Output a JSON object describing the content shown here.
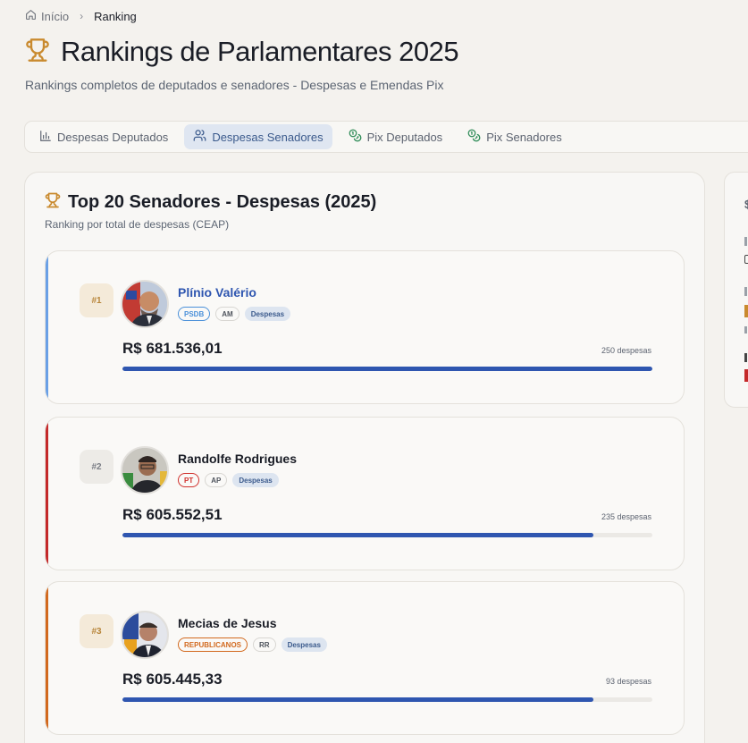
{
  "breadcrumb": {
    "home_label": "Início",
    "current": "Ranking"
  },
  "page": {
    "title": "Rankings de Parlamentares 2025",
    "subtitle": "Rankings completos de deputados e senadores - Despesas e Emendas Pix"
  },
  "tabs": [
    {
      "label": "Despesas Deputados",
      "icon": "bar-chart-icon",
      "active": false
    },
    {
      "label": "Despesas Senadores",
      "icon": "users-icon",
      "active": true
    },
    {
      "label": "Pix Deputados",
      "icon": "coins-icon",
      "active": false
    },
    {
      "label": "Pix Senadores",
      "icon": "coins-icon",
      "active": false
    }
  ],
  "section": {
    "title": "Top 20 Senadores - Despesas (2025)",
    "subtitle": "Ranking por total de despesas (CEAP)"
  },
  "ranking": [
    {
      "rank": "#1",
      "name": "Plínio Valério",
      "party": "PSDB",
      "state": "AM",
      "kind": "Despesas",
      "amount": "R$ 681.536,01",
      "count": "250 despesas",
      "progress": 1.0,
      "accent": "#6aa0e6",
      "name_color": "#2f56b0",
      "party_color": "#4a90d9",
      "badge_bg": "#f4ead9",
      "badge_color": "#b8863b"
    },
    {
      "rank": "#2",
      "name": "Randolfe Rodrigues",
      "party": "PT",
      "state": "AP",
      "kind": "Despesas",
      "amount": "R$ 605.552,51",
      "count": "235 despesas",
      "progress": 0.889,
      "accent": "#c4292a",
      "name_color": "#1a1d26",
      "party_color": "#d0312d",
      "badge_bg": "#edebe7",
      "badge_color": "#7a7d85"
    },
    {
      "rank": "#3",
      "name": "Mecias de Jesus",
      "party": "REPUBLICANOS",
      "state": "RR",
      "kind": "Despesas",
      "amount": "R$ 605.445,33",
      "count": "93 despesas",
      "progress": 0.888,
      "accent": "#d2691e",
      "name_color": "#1a1d26",
      "party_color": "#d2691e",
      "badge_bg": "#f4ead9",
      "badge_color": "#b8863b"
    }
  ],
  "colors": {
    "accent_gold": "#c98a2e",
    "tab_active_bg": "#dfe6f1",
    "progress": "#2f56b0"
  }
}
